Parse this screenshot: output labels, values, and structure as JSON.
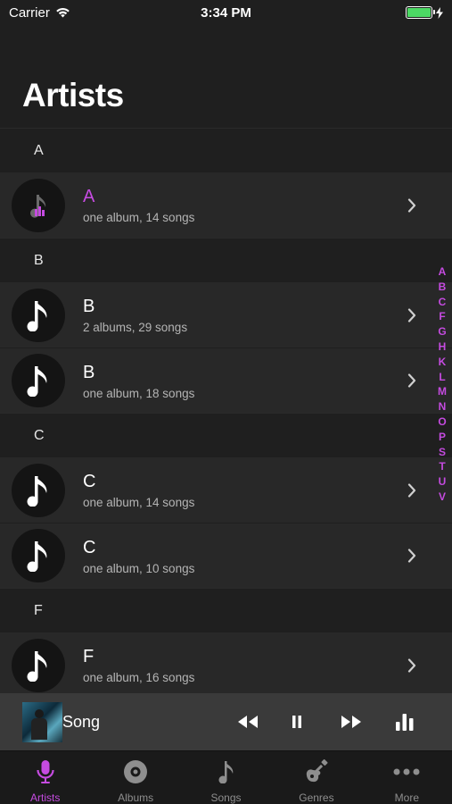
{
  "status": {
    "carrier": "Carrier",
    "time": "3:34 PM"
  },
  "title": "Artists",
  "sections": [
    {
      "letter": "A",
      "rows": [
        {
          "name": "A",
          "detail": "one album, 14 songs",
          "playing": true
        }
      ]
    },
    {
      "letter": "B",
      "rows": [
        {
          "name": "B",
          "detail": "2 albums, 29 songs"
        },
        {
          "name": "B",
          "detail": "one album, 18 songs"
        }
      ]
    },
    {
      "letter": "C",
      "rows": [
        {
          "name": "C",
          "detail": "one album, 14 songs"
        },
        {
          "name": "C",
          "detail": "one album, 10 songs"
        }
      ]
    },
    {
      "letter": "F",
      "rows": [
        {
          "name": "F",
          "detail": "one album, 16 songs"
        }
      ]
    }
  ],
  "index_letters": [
    "A",
    "B",
    "C",
    "F",
    "G",
    "H",
    "K",
    "L",
    "M",
    "N",
    "O",
    "P",
    "S",
    "T",
    "U",
    "V"
  ],
  "now_playing": {
    "title": "Song"
  },
  "tabs": [
    {
      "label": "Artists",
      "icon": "microphone-icon",
      "active": true
    },
    {
      "label": "Albums",
      "icon": "album-disc-icon"
    },
    {
      "label": "Songs",
      "icon": "music-note-icon"
    },
    {
      "label": "Genres",
      "icon": "guitar-icon"
    },
    {
      "label": "More",
      "icon": "more-dots-icon"
    }
  ],
  "colors": {
    "accent": "#c54be0",
    "background": "#1f1f1f",
    "row": "#282828",
    "battery": "#4cd964"
  }
}
